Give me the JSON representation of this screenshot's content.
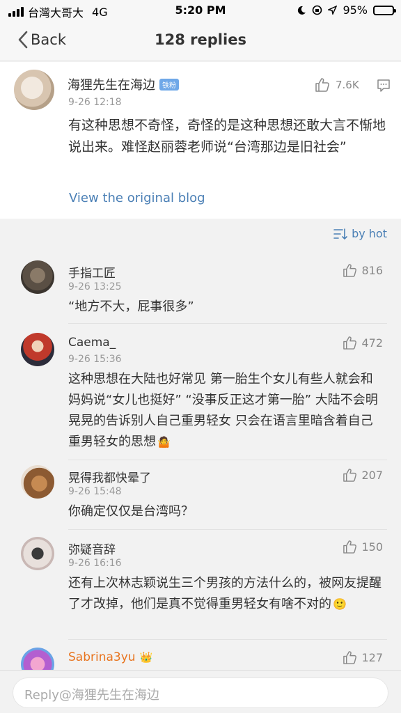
{
  "status_bar": {
    "carrier": "台灣大哥大",
    "network": "4G",
    "time": "5:20 PM",
    "battery": "95%",
    "battery_level": 0.95
  },
  "nav": {
    "back_label": "Back",
    "title": "128 replies"
  },
  "post": {
    "author": "海狸先生在海边",
    "badge": "铁粉",
    "time": "9-26 12:18",
    "likes": "7.6K",
    "text": "有这种思想不奇怪，奇怪的是这种思想还敢大言不惭地说出来。难怪赵丽蓉老师说“台湾那边是旧社会”",
    "link": "View the original blog"
  },
  "sort": {
    "label": "by hot"
  },
  "replies": [
    {
      "author": "手指工匠",
      "time": "9-26 13:25",
      "likes": "816",
      "text": "“地方不大，屁事很多”",
      "emoji": ""
    },
    {
      "author": "Caema_",
      "time": "9-26 15:36",
      "likes": "472",
      "text": "这种思想在大陆也好常见 第一胎生个女儿有些人就会和妈妈说“女儿也挺好” “没事反正这才第一胎” 大陆不会明晃晃的告诉别人自己重男轻女 只会在语言里暗含着自己重男轻女的思想",
      "emoji": "🤷"
    },
    {
      "author": "晃得我都快晕了",
      "time": "9-26 15:48",
      "likes": "207",
      "text": "你确定仅仅是台湾吗？",
      "emoji": ""
    },
    {
      "author": "弥疑音辞",
      "time": "9-26 16:16",
      "likes": "150",
      "text": "还有上次林志颖说生三个男孩的方法什么的，被网友提醒了才改掉，他们是真不觉得重男轻女有啥不对的",
      "emoji": "🙂"
    },
    {
      "author": "Sabrina3yu",
      "time": "",
      "likes": "127",
      "text": "",
      "emoji": "👑"
    }
  ],
  "reply_bar": {
    "placeholder": "Reply@海狸先生在海边"
  },
  "colors": {
    "link": "#4a7fb5",
    "special_name": "#e8741e"
  }
}
